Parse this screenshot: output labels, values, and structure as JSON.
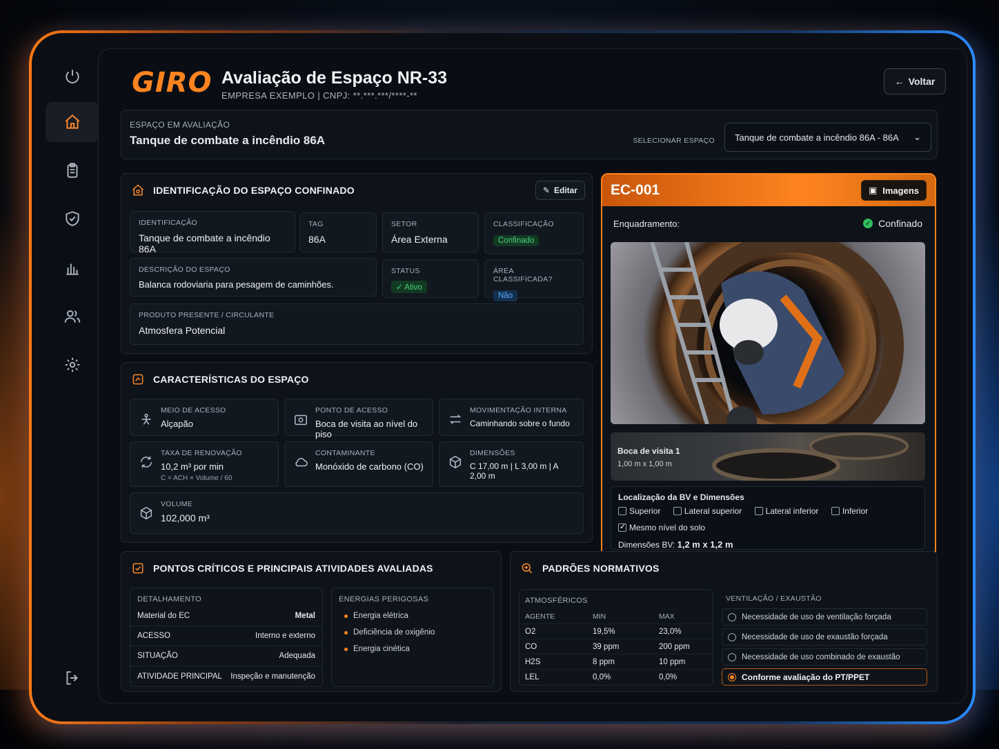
{
  "app": {
    "logo": "GIRO",
    "title": "Avaliação de Espaço NR-33",
    "company": "EMPRESA EXEMPLO  |  CNPJ: **.***.***/****-**",
    "back_label": "Voltar"
  },
  "sidebar": {
    "items": [
      {
        "icon": "power-icon"
      },
      {
        "icon": "home-icon",
        "active": true
      },
      {
        "icon": "clipboard-icon"
      },
      {
        "icon": "shield-check-icon"
      },
      {
        "icon": "bar-chart-icon"
      },
      {
        "icon": "users-icon"
      },
      {
        "icon": "gear-icon"
      },
      {
        "icon": "logout-icon"
      }
    ]
  },
  "space_bar": {
    "label": "ESPAÇO EM AVALIAÇÃO",
    "value": "Tanque de combate a incêndio 86A",
    "select_label": "SELECIONAR ESPAÇO",
    "select_value": "Tanque de combate a incêndio 86A - 86A"
  },
  "identificacao": {
    "title": "IDENTIFICAÇÃO DO ESPAÇO CONFINADO",
    "edit_label": "Editar",
    "id_label": "IDENTIFICAÇÃO",
    "id_value": "Tanque de combate a incêndio 86A",
    "tag_label": "TAG",
    "tag_value": "86A",
    "setor_label": "SETOR",
    "setor_value": "Área Externa",
    "class_label": "CLASSIFICAÇÃO",
    "class_value": "Confinado",
    "desc_label": "DESCRIÇÃO DO ESPAÇO",
    "desc_value": "Balanca rodoviaria para pesagem de caminhões.",
    "status_label": "STATUS",
    "status_value": "Ativo",
    "area_label": "ÁREA CLASSIFICADA?",
    "area_value": "Não",
    "produto_label": "PRODUTO PRESENTE / CIRCULANTE",
    "produto_value": "Atmosfera Potencial"
  },
  "caracteristicas": {
    "title": "CARACTERÍSTICAS DO ESPAÇO",
    "items": [
      {
        "label": "MEIO DE ACESSO",
        "value": "Alçapão",
        "icon": "hatch-icon"
      },
      {
        "label": "PONTO DE ACESSO",
        "value": "Boca de visita ao nível do piso",
        "icon": "access-point-icon"
      },
      {
        "label": "MOVIMENTAÇÃO INTERNA",
        "value": "Caminhando sobre o fundo",
        "icon": "arrows-swap-icon"
      },
      {
        "label": "TAXA DE RENOVAÇÃO",
        "value": "10,2 m³ por min",
        "note": "C = ACH × Volume / 60",
        "icon": "refresh-icon"
      },
      {
        "label": "CONTAMINANTE",
        "value": "Monóxido de carbono (CO)",
        "icon": "cloud-icon"
      },
      {
        "label": "DIMENSÕES",
        "value": "C 17,00 m | L 3,00 m | A 2,00 m",
        "icon": "cube-icon"
      },
      {
        "label": "VOLUME",
        "value": "102,000 m³",
        "icon": "volume-cube-icon"
      }
    ]
  },
  "ec": {
    "id": "EC-001",
    "images_label": "Imagens",
    "enquadramento_label": "Enquadramento:",
    "enquadramento_value": "Confinado",
    "bv_title": "Boca de visita 1",
    "bv_size": "1,00 m x 1,00 m",
    "loc_title": "Localização da BV e Dimensões",
    "checks": [
      {
        "label": "Superior",
        "checked": false
      },
      {
        "label": "Lateral superior",
        "checked": false
      },
      {
        "label": "Lateral inferior",
        "checked": false
      },
      {
        "label": "Inferior",
        "checked": false
      },
      {
        "label": "Mesmo nível do solo",
        "checked": true
      }
    ],
    "dim_label": "Dimensões BV:",
    "dim_value": "1,2 m x 1,2 m"
  },
  "pontos": {
    "title": "PONTOS CRÍTICOS E PRINCIPAIS ATIVIDADES AVALIADAS",
    "det_label": "DETALHAMENTO",
    "rows": [
      {
        "k": "Material do EC",
        "v": "Metal"
      },
      {
        "k": "ACESSO",
        "v": "Interno e externo"
      },
      {
        "k": "SITUAÇÃO",
        "v": "Adequada"
      },
      {
        "k": "ATIVIDADE PRINCIPAL",
        "v": "Inspeção e manutenção"
      }
    ],
    "energias_label": "ENERGIAS PERIGOSAS",
    "energias": [
      "Energia elétrica",
      "Deficiência de oxigênio",
      "Energia cinética"
    ]
  },
  "padroes": {
    "title": "PADRÕES NORMATIVOS",
    "atm_label": "ATMOSFÉRICOS",
    "headers": [
      "AGENTE",
      "MIN",
      "MAX"
    ],
    "rows": [
      [
        "O2",
        "19,5%",
        "23,0%"
      ],
      [
        "CO",
        "39 ppm",
        "200 ppm"
      ],
      [
        "H2S",
        "8 ppm",
        "10 ppm"
      ],
      [
        "LEL",
        "0,0%",
        "0,0%"
      ]
    ],
    "vent_label": "VENTILAÇÃO / EXAUSTÃO",
    "options": [
      {
        "label": "Necessidade de uso de ventilação forçada",
        "selected": false
      },
      {
        "label": "Necessidade de uso de exaustão forçada",
        "selected": false
      },
      {
        "label": "Necessidade de uso combinado de exaustão",
        "selected": false
      },
      {
        "label": "Conforme avaliação do PT/PPET",
        "selected": true
      }
    ]
  },
  "colors": {
    "accent": "#ff8420",
    "success": "#4ad07a",
    "info": "#5aa9ff",
    "bg": "#0a0e14"
  }
}
